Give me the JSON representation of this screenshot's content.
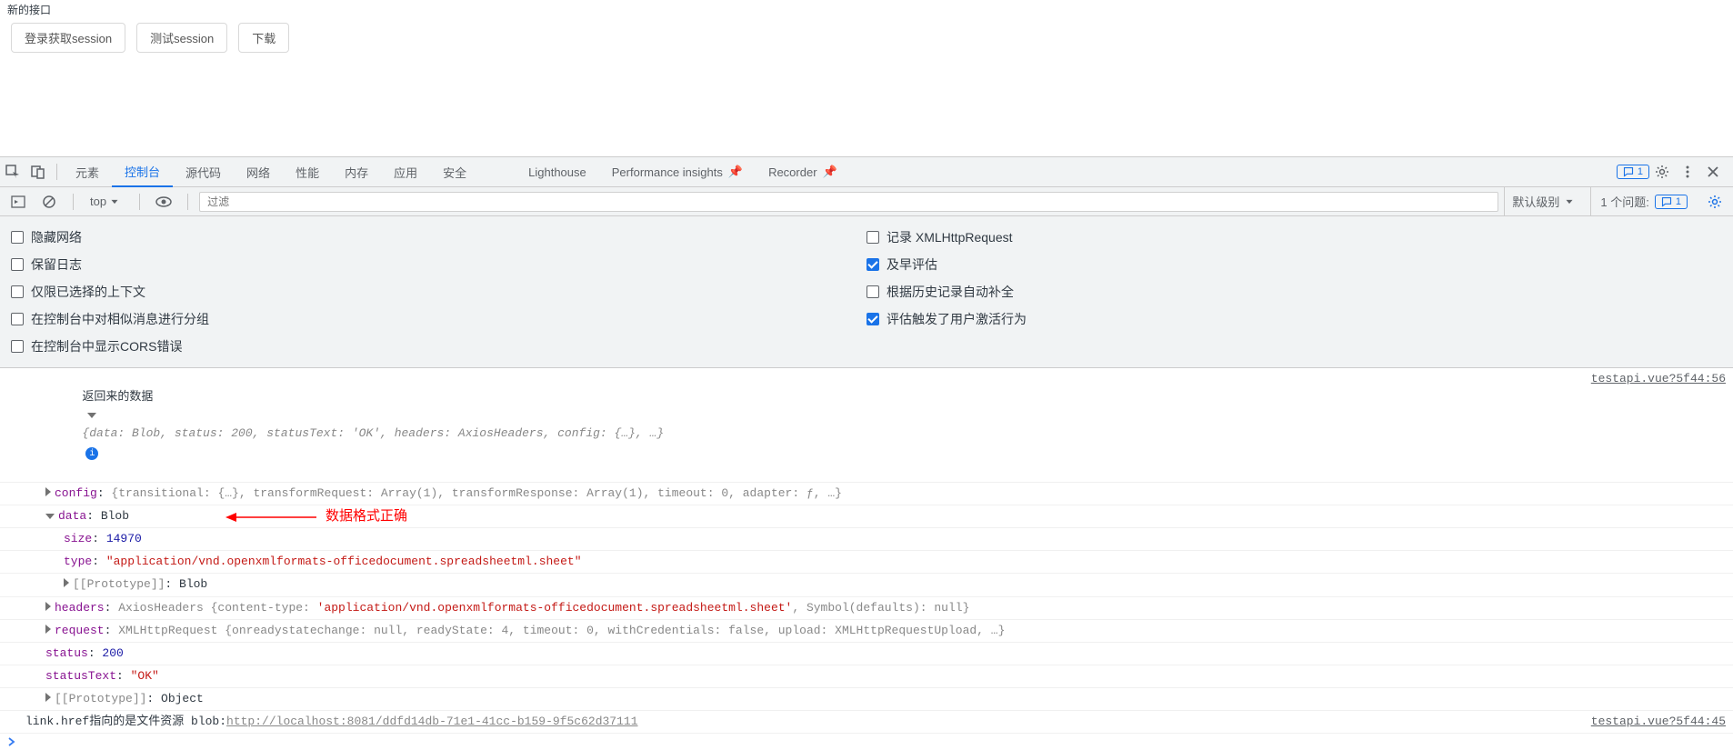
{
  "page": {
    "title": "新的接口",
    "buttons": {
      "login": "登录获取session",
      "test": "测试session",
      "download": "下载"
    }
  },
  "devtools": {
    "tabs": [
      "元素",
      "控制台",
      "源代码",
      "网络",
      "性能",
      "内存",
      "应用",
      "安全",
      "Lighthouse",
      "Performance insights",
      "Recorder"
    ],
    "activeTab": "控制台",
    "messageCount": "1"
  },
  "toolbar": {
    "context": "top",
    "filterPlaceholder": "过滤",
    "levelLabel": "默认级别",
    "issuesLabel": "1 个问题:",
    "issuesCount": "1"
  },
  "settings": {
    "left": [
      {
        "label": "隐藏网络",
        "checked": false
      },
      {
        "label": "保留日志",
        "checked": false
      },
      {
        "label": "仅限已选择的上下文",
        "checked": false
      },
      {
        "label": "在控制台中对相似消息进行分组",
        "checked": false
      },
      {
        "label": "在控制台中显示CORS错误",
        "checked": false
      }
    ],
    "right": [
      {
        "label": "记录 XMLHttpRequest",
        "checked": false
      },
      {
        "label": "及早评估",
        "checked": true
      },
      {
        "label": "根据历史记录自动补全",
        "checked": false
      },
      {
        "label": "评估触发了用户激活行为",
        "checked": true
      }
    ]
  },
  "log1": {
    "prefix": "返回来的数据",
    "summary_pre": "{data: Blob, status: ",
    "summary_status": "200",
    "summary_mid": ", statusText: ",
    "summary_ok": "'OK'",
    "summary_rest": ", headers: AxiosHeaders, config: {…}, …}",
    "config_key": "config",
    "config_val": "{transitional: {…}, transformRequest: Array(1), transformResponse: Array(1), timeout: 0, adapter: ƒ, …}",
    "data_key": "data",
    "data_val": "Blob",
    "annotation": "数据格式正确",
    "size_key": "size",
    "size_val": "14970",
    "type_key": "type",
    "type_val": "\"application/vnd.openxmlformats-officedocument.spreadsheetml.sheet\"",
    "proto1_key": "[[Prototype]]",
    "proto1_val": "Blob",
    "headers_key": "headers",
    "headers_pre": "AxiosHeaders {content-type: ",
    "headers_ct": "'application/vnd.openxmlformats-officedocument.spreadsheetml.sheet'",
    "headers_post": ", Symbol(defaults): null}",
    "request_key": "request",
    "request_val": "XMLHttpRequest {onreadystatechange: null, readyState: 4, timeout: 0, withCredentials: false, upload: XMLHttpRequestUpload, …}",
    "status_key": "status",
    "status_val": "200",
    "statusText_key": "statusText",
    "statusText_val": "\"OK\"",
    "proto2_key": "[[Prototype]]",
    "proto2_val": "Object",
    "source": "testapi.vue?5f44:56"
  },
  "log2": {
    "prefix": "link.href指向的是文件资源 blob:",
    "url": "http://localhost:8081/ddfd14db-71e1-41cc-b159-9f5c62d37111",
    "source": "testapi.vue?5f44:45"
  }
}
